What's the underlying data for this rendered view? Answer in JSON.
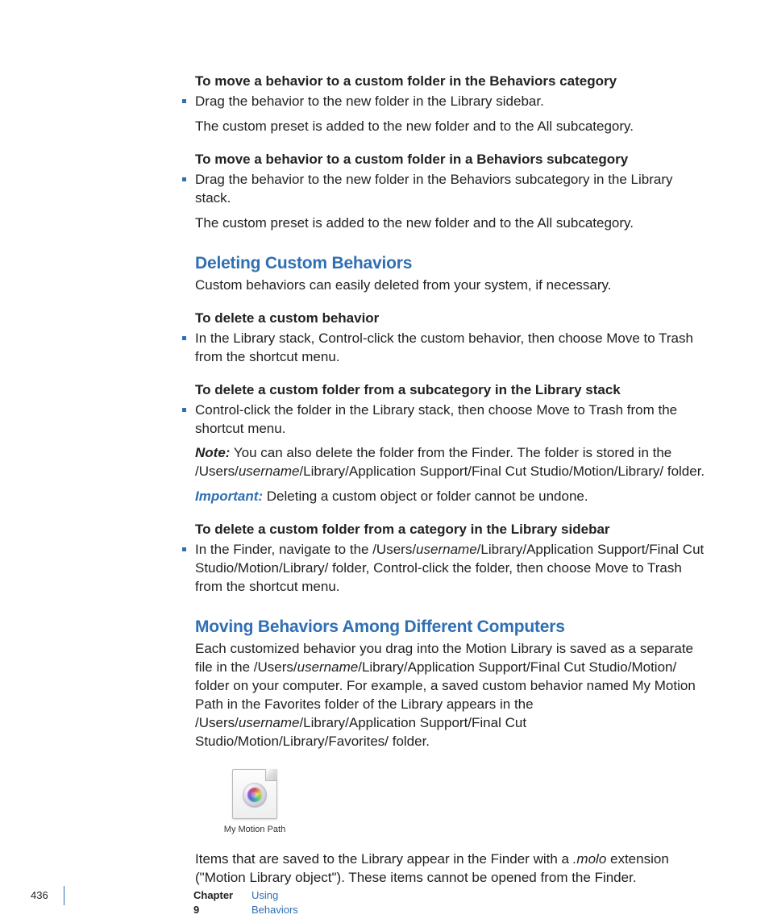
{
  "sections": {
    "s1": {
      "heading": "To move a behavior to a custom folder in the Behaviors category",
      "bullet": "Drag the behavior to the new folder in the Library sidebar.",
      "result": "The custom preset is added to the new folder and to the All subcategory."
    },
    "s2": {
      "heading": "To move a behavior to a custom folder in a Behaviors subcategory",
      "bullet": "Drag the behavior to the new folder in the Behaviors subcategory in the Library stack.",
      "result": "The custom preset is added to the new folder and to the All subcategory."
    },
    "deleting_heading": "Deleting Custom Behaviors",
    "deleting_intro": "Custom behaviors can easily deleted from your system, if necessary.",
    "s3": {
      "heading": "To delete a custom behavior",
      "bullet": "In the Library stack, Control-click the custom behavior, then choose Move to Trash from the shortcut menu."
    },
    "s4": {
      "heading": "To delete a custom folder from a subcategory in the Library stack",
      "bullet": "Control-click the folder in the Library stack, then choose Move to Trash from the shortcut menu.",
      "note_label": "Note:",
      "note_pre": "  You can also delete the folder from the Finder. The folder is stored in the /Users/",
      "note_user": "username",
      "note_post": "/Library/Application Support/Final Cut Studio/Motion/Library/ folder.",
      "important_label": "Important:",
      "important_text": "  Deleting a custom object or folder cannot be undone."
    },
    "s5": {
      "heading": "To delete a custom folder from a category in the Library sidebar",
      "bullet_pre": "In the Finder, navigate to the /Users/",
      "bullet_user": "username",
      "bullet_post": "/Library/Application Support/Final Cut Studio/Motion/Library/ folder, Control-click the folder, then choose Move to Trash from the shortcut menu."
    },
    "moving_heading": "Moving Behaviors Among Different Computers",
    "moving_p_a": "Each customized behavior you drag into the Motion Library is saved as a separate file in the /Users/",
    "moving_user1": "username",
    "moving_p_b": "/Library/Application Support/Final Cut Studio/Motion/ folder on your computer. For example, a saved custom behavior named My Motion Path in the Favorites folder of the Library appears in the /Users/",
    "moving_user2": "username",
    "moving_p_c": "/Library/Application Support/Final Cut Studio/Motion/Library/Favorites/ folder.",
    "icon_label": "My Motion Path",
    "closing_a": "Items that are saved to the Library appear in the Finder with a ",
    "closing_ext": ".molo",
    "closing_b": " extension (\"Motion Library object\"). These items cannot be opened from the Finder."
  },
  "footer": {
    "page": "436",
    "chapter": "Chapter 9",
    "title": "Using Behaviors"
  }
}
